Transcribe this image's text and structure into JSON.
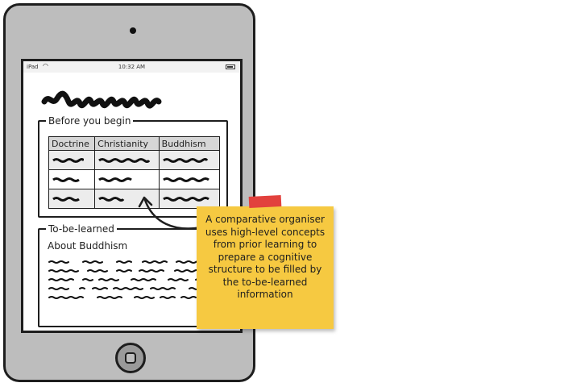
{
  "statusbar": {
    "device": "iPad",
    "time": "10:32 AM"
  },
  "before_section": {
    "legend": "Before you begin",
    "table": {
      "headers": [
        "Doctrine",
        "Christianity",
        "Buddhism"
      ]
    }
  },
  "learn_section": {
    "legend": "To-be-learned",
    "heading": "About Buddhism"
  },
  "note": {
    "text": "A comparative organiser uses high-level concepts from prior learning to prepare a cognitive structure to be filled by the to-be-learned information"
  },
  "colors": {
    "note": "#f6c941",
    "tape": "#e2413d",
    "tablet": "#bdbdbd",
    "table_header": "#d6d6d6"
  },
  "icons": [
    "wifi-icon",
    "battery-icon",
    "home-button-icon",
    "camera-icon"
  ]
}
